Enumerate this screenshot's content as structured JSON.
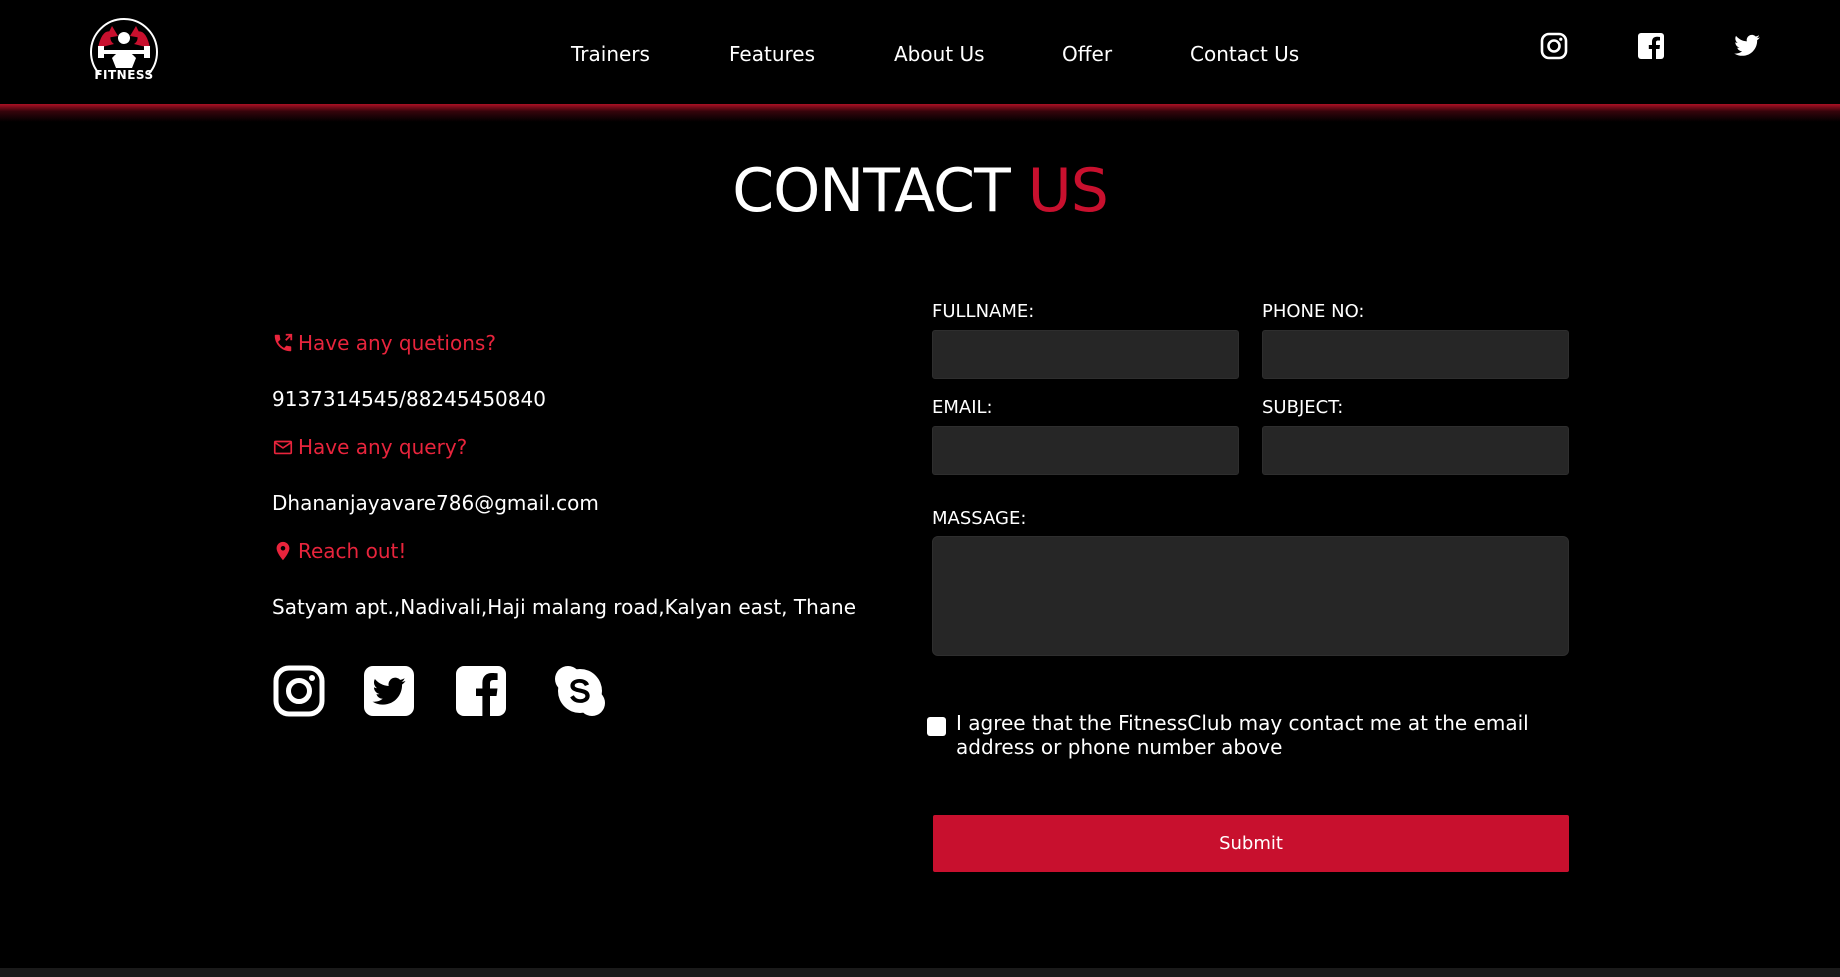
{
  "brand": {
    "logo_text": "FITNESS"
  },
  "nav": {
    "items": [
      {
        "label": "Trainers"
      },
      {
        "label": "Features"
      },
      {
        "label": "About Us"
      },
      {
        "label": "Offer"
      },
      {
        "label": "Contact Us"
      }
    ]
  },
  "header_social": [
    "instagram-icon",
    "facebook-icon",
    "twitter-icon"
  ],
  "title": {
    "main": "CONTACT",
    "accent": "US"
  },
  "contact_info": {
    "phone_heading": "Have any quetions?",
    "phone": "9137314545/88245450840",
    "email_heading": "Have any query?",
    "email": "Dhananjayavare786@gmail.com",
    "address_heading": "Reach out!",
    "address": "Satyam apt.,Nadivali,Haji malang road,Kalyan east, Thane"
  },
  "content_social": [
    "instagram-icon",
    "twitter-icon",
    "facebook-icon",
    "skype-icon"
  ],
  "form": {
    "fullname_label": "FULLNAME:",
    "fullname_value": "",
    "phone_label": "PHONE NO:",
    "phone_value": "",
    "email_label": "EMAIL:",
    "email_value": "",
    "subject_label": "SUBJECT:",
    "subject_value": "",
    "message_label": "MASSAGE:",
    "message_value": "",
    "agree_text": "I agree that the FitnessClub may contact me at the email address or phone number above",
    "agree_checked": false,
    "submit_label": "Submit"
  },
  "colors": {
    "accent": "#c8102e",
    "accent_text": "#e8243c",
    "background": "#000000",
    "field_bg": "#262626"
  }
}
